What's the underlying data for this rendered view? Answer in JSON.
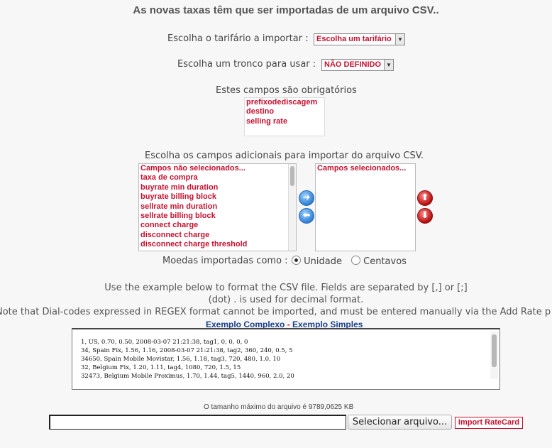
{
  "title": "As novas taxas têm que ser importadas de um arquivo CSV..",
  "tariff": {
    "label": "Escolha o tarifário a importar :",
    "selected": "Escolha um tarifário"
  },
  "trunk": {
    "label": "Escolha um tronco para usar :",
    "selected": "NÃO DEFINIDO"
  },
  "required": {
    "label": "Estes campos são obrigatórios",
    "items": [
      "prefixodediscagem",
      "destino",
      "selling rate"
    ]
  },
  "additional": {
    "label": "Escolha os campos adicionais para importar do arquivo CSV.",
    "available": [
      "Campos não selecionados...",
      "taxa de compra",
      "buyrate min duration",
      "buyrate billing block",
      "sellrate min duration",
      "sellrate billing block",
      "connect charge",
      "disconnect charge",
      "disconnect charge threshold"
    ],
    "selected": [
      "Campos selecionados..."
    ],
    "add_icon": "arrow-right-icon",
    "remove_icon": "arrow-left-icon",
    "up_icon": "arrow-up-icon",
    "down_icon": "arrow-down-icon"
  },
  "currency": {
    "label": "Moedas importadas como :",
    "option_unit": "Unidade",
    "option_cents": "Centavos",
    "selected": "Unidade"
  },
  "info": {
    "line1": "Use the example below to format the CSV file. Fields are separated by [,] or [;]",
    "line2": "(dot) . is used for decimal format.",
    "line3": "Note that Dial-codes expressed in REGEX format cannot be imported, and must be entered manually via the Add Rate p"
  },
  "examples": {
    "complex": "Exemplo Complexo",
    "separator": "-",
    "simple": "Exemplo Simples"
  },
  "example_lines": [
    "1, US, 0.70, 0.50, 2008-03-07 21:21:38, tag1, 0, 0, 0, 0",
    "34, Spain Fix, 1.56, 1.16, 2008-03-07 21:21:38, tag2, 360, 240, 0.5, 5",
    "34650, Spain Mobile Movistar, 1.56, 1.18, tag3, 720, 480, 1.0, 10",
    "32, Belgium Fix, 1.20, 1.11, tag4, 1080, 720, 1.5, 15",
    "32473, Belgium Mobile Proximus, 1.70, 1.44, tag5, 1440, 960, 2.0, 20"
  ],
  "file": {
    "max_size": "O tamanho máximo do arquivo é 9789,0625 KB",
    "choose_button": "Selecionar arquivo...",
    "import_button": "Import RateCard"
  }
}
